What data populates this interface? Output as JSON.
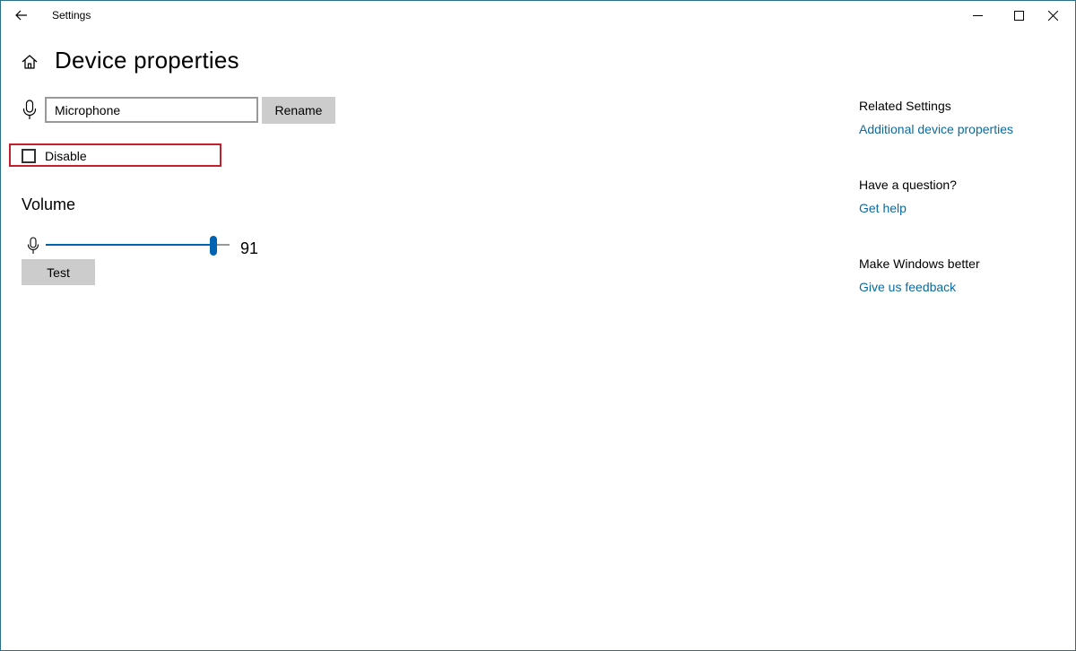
{
  "window": {
    "title": "Settings"
  },
  "header": {
    "page_title": "Device properties"
  },
  "device": {
    "name_value": "Microphone",
    "rename_label": "Rename",
    "disable_label": "Disable",
    "disable_checked": false
  },
  "volume": {
    "title": "Volume",
    "value": 91,
    "value_text": "91",
    "test_label": "Test"
  },
  "sidebar": {
    "related_heading": "Related Settings",
    "related_link": "Additional device properties",
    "question_heading": "Have a question?",
    "question_link": "Get help",
    "better_heading": "Make Windows better",
    "better_link": "Give us feedback"
  },
  "colors": {
    "accent": "#0063b1",
    "link": "#0b6a9f",
    "highlight": "#c3202e",
    "button_bg": "#cccccc",
    "window_border": "#2b6f8a"
  },
  "icons": {
    "back": "back-arrow-icon",
    "home": "home-icon",
    "microphone": "microphone-icon",
    "minimize": "minimize-icon",
    "maximize": "maximize-icon",
    "close": "close-icon"
  }
}
